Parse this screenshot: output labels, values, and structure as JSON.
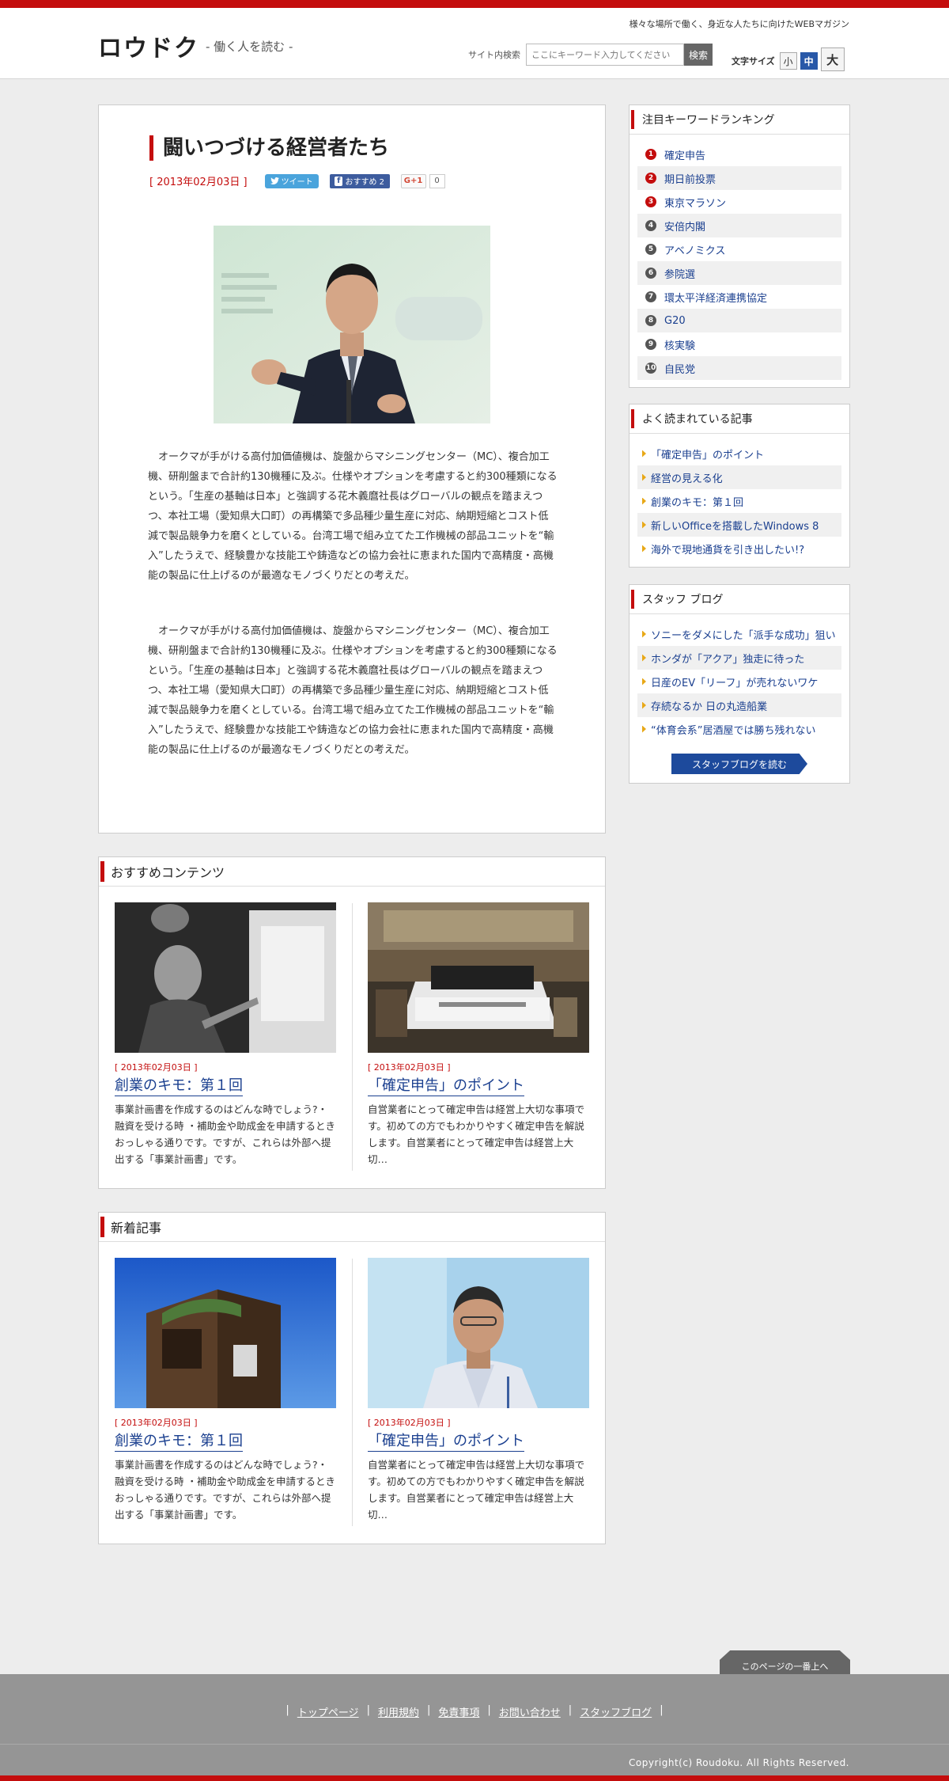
{
  "header": {
    "logo": "ロウドク",
    "tagline": "- 働く人を読む -",
    "catchphrase": "様々な場所で働く、身近な人たちに向けたWEBマガジン",
    "search_label": "サイト内検索",
    "search_placeholder": "ここにキーワード入力してください",
    "search_button": "検索",
    "fontsize_label": "文字サイズ",
    "fontsize_small": "小",
    "fontsize_medium": "中",
    "fontsize_large": "大",
    "fontsize_selected": "中"
  },
  "article": {
    "title": "闘いつづける経営者たち",
    "date": "[ 2013年02月03日 ]",
    "tweet_label": "ツイート",
    "fb_label": "おすすめ 2",
    "gplus_label": "G+1",
    "gplus_count": "0",
    "paragraph1": "オークマが手がける高付加価値機は、旋盤からマシニングセンター（MC）、複合加工機、研削盤まで合計約130機種に及ぶ。仕様やオプションを考慮すると約300種類になるという。「生産の基軸は日本」と強調する花木義麿社長はグローバルの観点を踏まえつつ、本社工場（愛知県大口町）の再構築で多品種少量生産に対応、納期短縮とコスト低減で製品競争力を磨くとしている。台湾工場で組み立てた工作機械の部品ユニットを“輸入”したうえで、経験豊かな技能工や鋳造などの協力会社に恵まれた国内で高精度・高機能の製品に仕上げるのが最適なモノづくりだとの考えだ。",
    "paragraph2": "オークマが手がける高付加価値機は、旋盤からマシニングセンター（MC）、複合加工機、研削盤まで合計約130機種に及ぶ。仕様やオプションを考慮すると約300種類になるという。「生産の基軸は日本」と強調する花木義麿社長はグローバルの観点を踏まえつつ、本社工場（愛知県大口町）の再構築で多品種少量生産に対応、納期短縮とコスト低減で製品競争力を磨くとしている。台湾工場で組み立てた工作機械の部品ユニットを“輸入”したうえで、経験豊かな技能工や鋳造などの協力会社に恵まれた国内で高精度・高機能の製品に仕上げるのが最適なモノづくりだとの考えだ。"
  },
  "recommended": {
    "heading": "おすすめコンテンツ",
    "cards": [
      {
        "date": "[ 2013年02月03日 ]",
        "title": "創業のキモ：第１回",
        "text": "事業計画書を作成するのはどんな時でしょう?・融資を受ける時 ・補助金や助成金を申請するとき おっしゃる通りです。ですが、これらは外部へ提出する「事業計画書」です。"
      },
      {
        "date": "[ 2013年02月03日 ]",
        "title": "「確定申告」のポイント",
        "text": "自営業者にとって確定申告は経営上大切な事項です。初めての方でもわかりやすく確定申告を解説します。自営業者にとって確定申告は経営上大切…"
      }
    ]
  },
  "newest": {
    "heading": "新着記事",
    "cards": [
      {
        "date": "[ 2013年02月03日 ]",
        "title": "創業のキモ：第１回",
        "text": "事業計画書を作成するのはどんな時でしょう?・融資を受ける時 ・補助金や助成金を申請するとき おっしゃる通りです。ですが、これらは外部へ提出する「事業計画書」です。"
      },
      {
        "date": "[ 2013年02月03日 ]",
        "title": "「確定申告」のポイント",
        "text": "自営業者にとって確定申告は経営上大切な事項です。初めての方でもわかりやすく確定申告を解説します。自営業者にとって確定申告は経営上大切…"
      }
    ]
  },
  "sidebar": {
    "ranking": {
      "heading": "注目キーワードランキング",
      "items": [
        {
          "rank": "1",
          "label": "確定申告"
        },
        {
          "rank": "2",
          "label": "期日前投票"
        },
        {
          "rank": "3",
          "label": "東京マラソン"
        },
        {
          "rank": "4",
          "label": "安倍内閣"
        },
        {
          "rank": "5",
          "label": "アベノミクス"
        },
        {
          "rank": "6",
          "label": "参院選"
        },
        {
          "rank": "7",
          "label": "環太平洋経済連携協定"
        },
        {
          "rank": "8",
          "label": "G20"
        },
        {
          "rank": "9",
          "label": "核実験"
        },
        {
          "rank": "10",
          "label": "自民党"
        }
      ]
    },
    "popular": {
      "heading": "よく読まれている記事",
      "items": [
        "「確定申告」のポイント",
        "経営の見える化",
        "創業のキモ：第１回",
        "新しいOfficeを搭載したWindows 8",
        "海外で現地通貨を引き出したい!?"
      ]
    },
    "staff_blog": {
      "heading": "スタッフ ブログ",
      "items": [
        "ソニーをダメにした「派手な成功」狙い",
        "ホンダが「アクア」独走に待った",
        "日産のEV「リーフ」が売れないワケ",
        "存続なるか 日の丸造船業",
        "“体育会系”居酒屋では勝ち残れない"
      ],
      "button": "スタッフブログを読む"
    }
  },
  "footer": {
    "pagetop": "このページの一番上へ",
    "links": [
      "トップページ",
      "利用規約",
      "免責事項",
      "お問い合わせ",
      "スタッフブログ"
    ],
    "copyright": "Copyright(c) Roudoku. All Rights Reserved."
  },
  "colors": {
    "accent": "#c40d0d",
    "link": "#1a3f8f",
    "footer": "#959595"
  },
  "icons": {
    "tweet": "twitter-bird-icon",
    "facebook": "facebook-icon",
    "gplus": "google-plus-icon",
    "rank_badge": "rank-circle-icon",
    "bullet": "arrow-bullet-icon"
  }
}
